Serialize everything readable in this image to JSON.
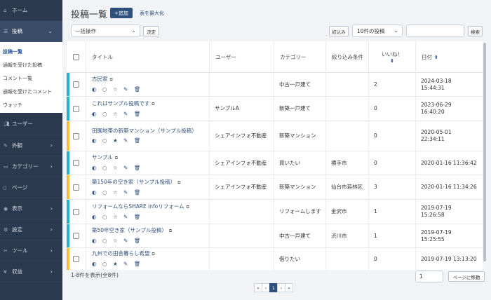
{
  "sidebar": {
    "home": "ホーム",
    "posts": "投稿",
    "submenu": [
      "投稿一覧",
      "通報を受けた投稿",
      "コメント一覧",
      "通報を受けたコメント",
      "ウォッチ"
    ],
    "items": [
      "ユーザー",
      "外観",
      "カテゴリー",
      "ページ",
      "表示",
      "設定",
      "ツール",
      "収益"
    ]
  },
  "header": {
    "title": "投稿一覧",
    "add_label": "+追加",
    "maximize_label": "表を最大化"
  },
  "toolbar": {
    "bulk_action": "一括操作",
    "apply_label": "決定",
    "filter_label": "絞込み",
    "per_page": "10件の投稿",
    "search_label": "検索"
  },
  "columns": {
    "title": "タイトル",
    "user": "ユーザー",
    "category": "カテゴリー",
    "filter": "絞り込み条件",
    "likes": "いいね！",
    "date": "日付"
  },
  "rows": [
    {
      "title": "古民家",
      "user": "",
      "category": "中古一戸建て",
      "filter": "",
      "likes": "2",
      "date": "2024-03-18 15:44:31",
      "color": "#27b3c6"
    },
    {
      "title": "これはサンプル投稿です",
      "user": "サンプルA",
      "category": "新築一戸建て",
      "filter": "",
      "likes": "0",
      "date": "2023-06-29 16:40:20",
      "color": "#27b3c6"
    },
    {
      "title": "田園地帯の新築マンション（サンプル投稿）",
      "user": "シェアインフォ不動産",
      "category": "新築マンション",
      "filter": "",
      "likes": "0",
      "date": "2020-05-01 22:34:11",
      "color": "#f0bf3c"
    },
    {
      "title": "サンプル",
      "user": "シェアインフォ不動産",
      "category": "買いたい",
      "filter": "横手市",
      "likes": "0",
      "date": "2020-01-16 11:36:42",
      "color": "#27b3c6"
    },
    {
      "title": "築150年の空き家（サンプル投稿）",
      "user": "シェアインフォ不動産",
      "category": "新築マンション",
      "filter": "仙台市若林区",
      "likes": "3",
      "date": "2020-01-16 11:34:26",
      "color": "#f0bf3c"
    },
    {
      "title": "リフォームならSHARE infoリフォーム",
      "user": "",
      "category": "リフォームします",
      "filter": "金沢市",
      "likes": "1",
      "date": "2019-07-19 15:26:58",
      "color": "#27b3c6"
    },
    {
      "title": "築50年空き家（サンプル投稿）",
      "user": "",
      "category": "中古一戸建て",
      "filter": "渋川市",
      "likes": "1",
      "date": "2019-07-19 15:25:55",
      "color": "#27b3c6"
    },
    {
      "title": "九州での田舎暮らし希望",
      "user": "",
      "category": "借りたい",
      "filter": "",
      "likes": "0",
      "date": "2019-07-19 13:13:20",
      "color": "#f0bf3c"
    }
  ],
  "footer": {
    "count_text": "1-8件を表示(全8件)",
    "page_input": "1",
    "goto_label": "ページに移動",
    "pager": [
      "«",
      "‹",
      "1",
      "›",
      "»"
    ]
  },
  "colors": {
    "accent": "#2f4f7c",
    "sidebar": "#2b3a4f",
    "teal": "#27b3c6",
    "yellow": "#f0bf3c"
  }
}
